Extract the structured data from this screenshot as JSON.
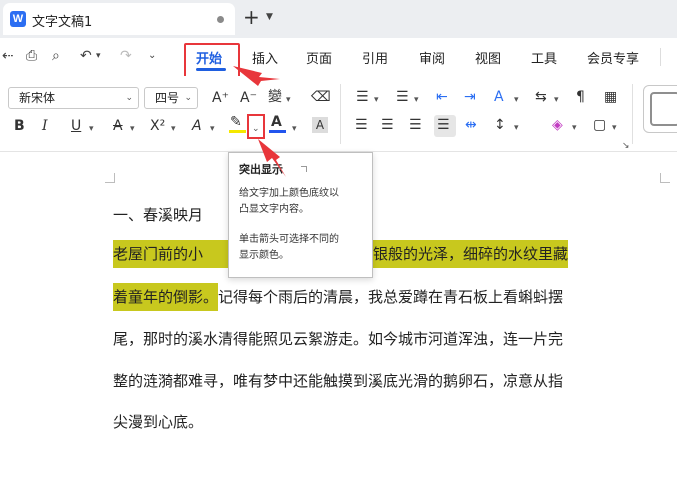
{
  "titlebar": {
    "app_logo_letter": "W",
    "doc_title": "文字文稿1",
    "new_tab_symbol": "+",
    "dropdown_symbol": "⌄"
  },
  "menu": {
    "items": [
      "开始",
      "插入",
      "页面",
      "引用",
      "审阅",
      "视图",
      "工具",
      "会员专享"
    ],
    "active": "开始"
  },
  "ribbon": {
    "font_name": "新宋体",
    "font_size": "四号",
    "bold_label": "B",
    "italic_label": "I",
    "underline_label": "U",
    "superscript_label": "X²",
    "grow_font_label": "A⁺",
    "shrink_font_label": "A⁻",
    "font_color_label": "A",
    "char_shading_label": "A",
    "highlight_color": "#f5e800",
    "font_color_bar": "#2255ee"
  },
  "tooltip": {
    "title": "突出显示",
    "line1": "给文字加上颜色底纹以",
    "line2": "凸显文字内容。",
    "line3": "单击箭头可选择不同的",
    "line4": "显示颜色。"
  },
  "document": {
    "heading": "一、春溪映月",
    "line1_highlight_a": "老屋门前的小",
    "line1_highlight_b": "泛着碎银般的光泽，细碎的水纹里藏",
    "line2_highlight": "着童年的倒影。",
    "line2_rest": "记得每个雨后的清晨，我总爱蹲在青石板上看蝌蚪摆",
    "line3": "尾，那时的溪水清得能照见云絮游走。如今城市河道浑浊，连一片完",
    "line4": "整的涟漪都难寻，唯有梦中还能触摸到溪底光滑的鹅卵石，凉意从指",
    "line5": "尖漫到心底。"
  },
  "colors": {
    "accent_blue": "#1f5fe0",
    "annotation_red": "#e8363b",
    "text_highlight": "#c8c81e"
  }
}
